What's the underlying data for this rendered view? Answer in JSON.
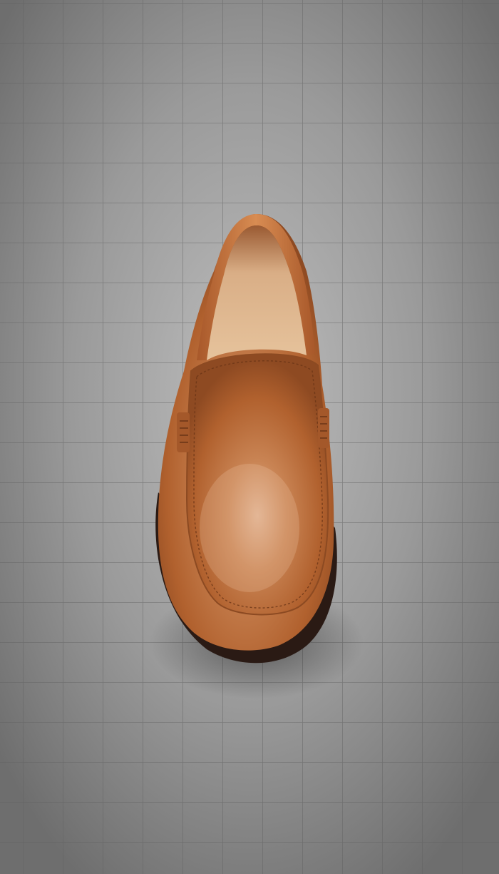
{
  "photo": {
    "subject": "loafer-shoe",
    "shoe_color": "#b5652f",
    "lining_color": "#e2bd94",
    "sole_color": "#2a1a14",
    "background_color": "#8a8a8a",
    "grid_line_color": "#6a6a6a"
  }
}
